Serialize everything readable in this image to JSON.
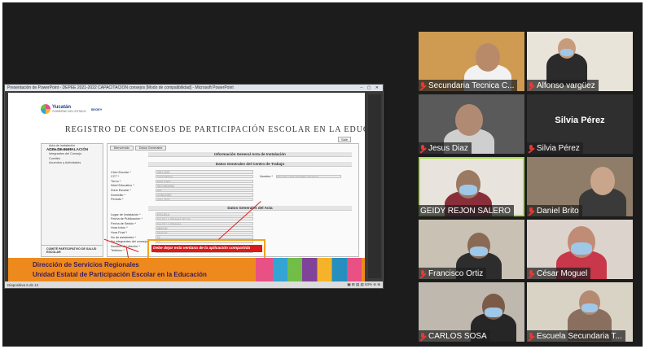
{
  "share": {
    "window_title": "Presentación de PowerPoint - DEPEE 2021-2022 CAPACITACIÓN consejos [Modo de compatibilidad] - Microsoft PowerPoint",
    "window_controls": "–  ▢  ✕",
    "status_left": "Diapositiva 6 de 12",
    "status_right": "▣ ⊞ ▤ ▥ 63% ⊖ ⊕",
    "logo": {
      "text": "Yucatán",
      "sub": "GOBIERNO DEL ESTADO",
      "seg": "SEGEY"
    },
    "slide_title": "REGISTRO DE CONSEJOS DE PARTICIPACIÓN ESCOLAR EN LA EDUCACIÓN",
    "salir": "Salir",
    "left_panel": {
      "heading": "ACTA DE INSTALACIÓN",
      "items": [
        "Acta de instalación",
        "Datos Generales",
        "Integrantes del Consejo",
        "Comités",
        "Acuerdos y Actividades"
      ],
      "footer": "COMITÉ PARTICIPATIVO DE SALUD ESCOLAR"
    },
    "tabs": [
      "Bienvenido",
      "Datos Generales"
    ],
    "sections": [
      "Información General Acta de Instalación",
      "Datos Generales del Centro de Trabajo",
      "Datos Generales del Acta"
    ],
    "fields_ct": [
      {
        "label": "Ciclo Escolar *",
        "value": "2021-2022"
      },
      {
        "label": "CCT *",
        "value": "31ETV0000A",
        "label2": "Nombre *",
        "value2": "ESCUELA SECUNDARIA TÉCNICA"
      },
      {
        "label": "Turno *",
        "value": "MATUTINO"
      },
      {
        "label": "Nivel Educativo *",
        "value": "SECUNDARIA"
      },
      {
        "label": "Zona Escolar *",
        "value": "000"
      },
      {
        "label": "Domicilio *",
        "value": "CONOCIDO"
      },
      {
        "label": "Periodo *",
        "value": "2021-2022"
      }
    ],
    "fields_acta": [
      {
        "label": "Lugar de Instalación *",
        "value": "ESCUELA"
      },
      {
        "label": "Fecha de Publicación *",
        "value": "DIA DE LA SEMANA DE DIA"
      },
      {
        "label": "Fecha de Sesión *",
        "value": "DIA DE LA SEMANA"
      },
      {
        "label": "Hora Inicio *",
        "value": "08:00:00"
      },
      {
        "label": "Hora Final *",
        "value": "09:00:00"
      },
      {
        "label": "No de asistentes *",
        "value": "12"
      },
      {
        "label": "No integrantes del consejo *",
        "value": "10"
      },
      {
        "label": "Nombre del director *",
        "value": "NOMBRE DEL DIRECTOR"
      },
      {
        "label": "Teléfono *",
        "value": "9999999999"
      }
    ],
    "alert": "Debe dejar esta ventana de la aplicación compartida",
    "banner_line1": "Dirección de Servicios Regionales",
    "banner_line2": "Unidad Estatal de Participación Escolar en la Educación"
  },
  "participants": [
    {
      "name": "Secundaria Tecnica C...",
      "muted": true
    },
    {
      "name": "Alfonso vargüez",
      "muted": true
    },
    {
      "name": "Jesus Diaz",
      "muted": true
    },
    {
      "name": "Silvia Pérez",
      "muted": true,
      "big_name": "Silvia Pérez"
    },
    {
      "name": "GEIDY REJON SALERO",
      "muted": false,
      "active": true
    },
    {
      "name": "Daniel Brito",
      "muted": true
    },
    {
      "name": "Francisco Ortiz",
      "muted": true
    },
    {
      "name": "César Moguel",
      "muted": true
    },
    {
      "name": "CARLOS SOSA",
      "muted": true
    },
    {
      "name": "Escuela Secundaria T...",
      "muted": true
    }
  ],
  "colors": {
    "banner": "#ee8a1d",
    "banner_text": "#3b1c5c",
    "alert_border": "#f3a51b",
    "alert_fill": "#d81b1b",
    "active_speaker": "#a7e23a",
    "mic_muted": "#e53935"
  },
  "icons": [
    "microphone-muted-icon"
  ]
}
